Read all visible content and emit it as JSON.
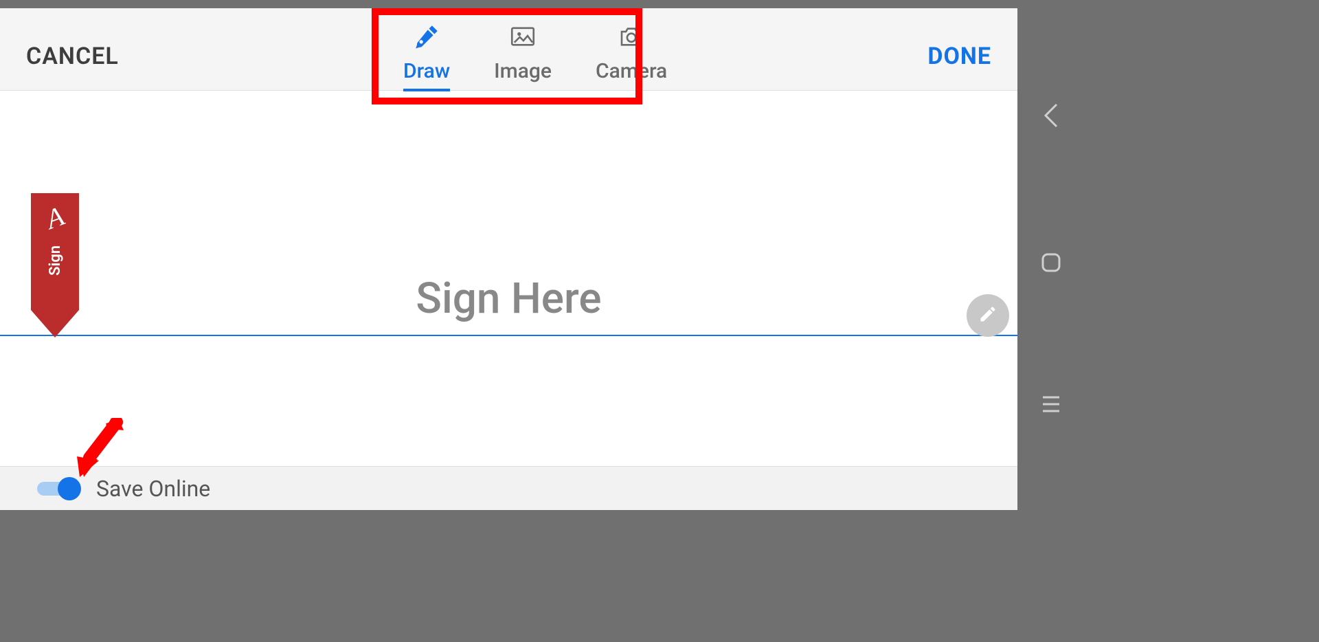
{
  "toolbar": {
    "cancel_label": "CANCEL",
    "done_label": "DONE",
    "tabs": [
      {
        "label": "Draw",
        "icon": "pen-icon",
        "active": true
      },
      {
        "label": "Image",
        "icon": "image-icon",
        "active": false
      },
      {
        "label": "Camera",
        "icon": "camera-icon",
        "active": false
      }
    ]
  },
  "canvas": {
    "placeholder": "Sign Here"
  },
  "bookmark": {
    "text": "Sign"
  },
  "bottom": {
    "save_online_label": "Save Online",
    "save_online_on": true
  },
  "annotations": {
    "highlight_tabs": true,
    "arrow_to_toggle": true
  },
  "colors": {
    "accent": "#1473e6",
    "highlight": "#ff0000",
    "bookmark": "#bb2d2d"
  }
}
